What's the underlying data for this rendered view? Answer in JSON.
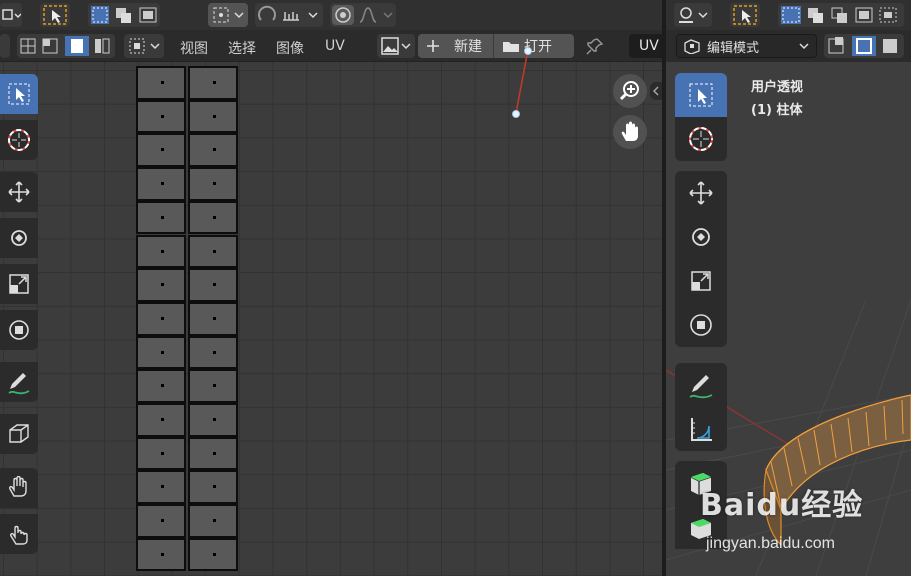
{
  "uv_editor": {
    "menu": {
      "view": "视图",
      "select": "选择",
      "image": "图像",
      "uv": "UV"
    },
    "image_controls": {
      "new_label": "新建",
      "open_label": "打开"
    },
    "uv_tab_label": "UV",
    "uv_grid": {
      "rows": 15,
      "columns": 2
    }
  },
  "viewport_3d": {
    "mode_label": "编辑模式",
    "view_title": "用户透视",
    "object_label": "(1) 柱体"
  },
  "watermark": {
    "brand": "Baidu经验",
    "url": "jingyan.baidu.com"
  },
  "colors": {
    "active_tool": "#4772b3",
    "selection_orange": "#e08a2a",
    "annotation_arrow": "#c0392b"
  }
}
